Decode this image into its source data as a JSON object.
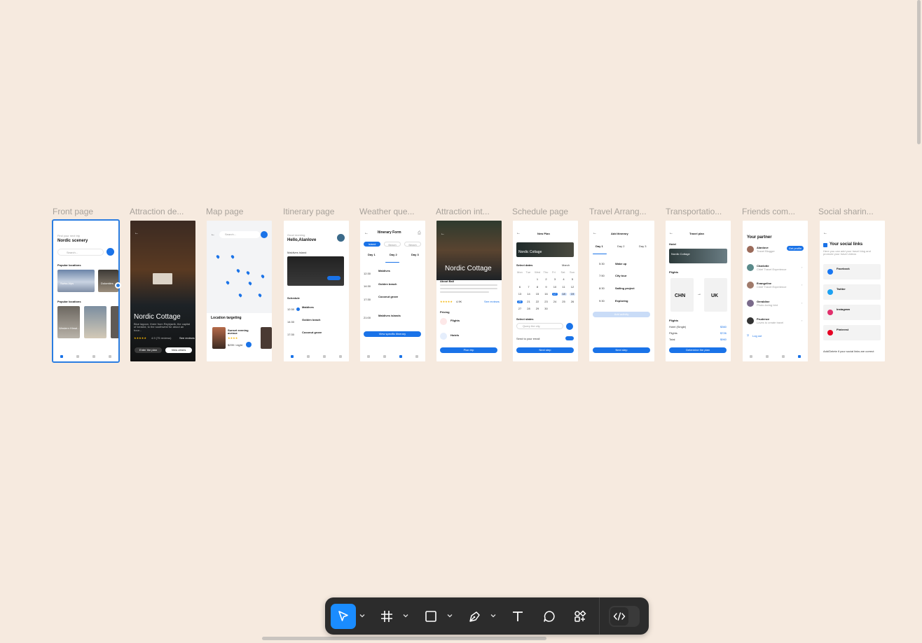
{
  "canvas": {
    "background": "#f6eadf",
    "accent": "#2a7de1"
  },
  "frames": [
    {
      "label": "Front page"
    },
    {
      "label": "Attraction de..."
    },
    {
      "label": "Map page"
    },
    {
      "label": "Itinerary page"
    },
    {
      "label": "Weather que..."
    },
    {
      "label": "Attraction int..."
    },
    {
      "label": "Schedule page"
    },
    {
      "label": "Travel Arrang..."
    },
    {
      "label": "Transportatio..."
    },
    {
      "label": "Friends com..."
    },
    {
      "label": "Social sharin..."
    }
  ],
  "front": {
    "kicker": "Find your next trip",
    "title": "Nordic scenery",
    "search_placeholder": "Search...",
    "section1": "Popular locations",
    "card1": "Swiss Alps",
    "card2": "Dolomites",
    "section2": "Popular locations",
    "card3": "Western Himal..."
  },
  "attraction": {
    "title": "Nordic Cottage",
    "desc": "Blue lagoon, three from Reykjavik, the capital of Iceland, to the southwest for about an hour...",
    "rating": "4.9 (75 reviews)",
    "see_reviews": "See reviews",
    "btn_plan": "Enter the plan",
    "btn_others": "View others"
  },
  "map": {
    "search_placeholder": "Search...",
    "section": "Location targeting",
    "place": "Sunset evening avenue",
    "price": "$299 / night"
  },
  "itinerary": {
    "greet": "Good morning",
    "name": "Hello,Alanlove",
    "island": "Maldives island",
    "schedule": "Schedule",
    "items": [
      {
        "time": "12:30",
        "title": "Maldives"
      },
      {
        "time": "14:30",
        "title": "Golden beach"
      },
      {
        "time": "17:30",
        "title": "Coconut grove"
      }
    ]
  },
  "weather": {
    "title": "Itinerary Form",
    "chips": [
      "Island",
      "Beach",
      "Beach"
    ],
    "days": [
      "Day 1",
      "Day 2",
      "Day 3"
    ],
    "items": [
      {
        "time": "12:30",
        "title": "Maldives"
      },
      {
        "time": "14:30",
        "title": "Golden beach"
      },
      {
        "time": "17:30",
        "title": "Coconut grove"
      },
      {
        "time": "21:00",
        "title": "Maldives islands"
      }
    ],
    "cta": "View specific itinerary"
  },
  "attraction_info": {
    "title": "Nordic Cottage",
    "about": "About Bali",
    "rating": "4.9K",
    "see_more": "See reviews",
    "pricing": "Pricing",
    "flights": "Flights",
    "hotels": "Hotels",
    "cta": "Plan trip"
  },
  "schedule": {
    "title": "New Plan",
    "banner": "Nordic Cottage",
    "select_dates": "Select dates",
    "month": "March",
    "weekdays": [
      "Mon",
      "Tue",
      "Wed",
      "Thu",
      "Fri",
      "Sat",
      "Sun"
    ],
    "days": [
      "",
      "",
      "1",
      "2",
      "3",
      "4",
      "5",
      "6",
      "7",
      "8",
      "9",
      "10",
      "11",
      "12",
      "13",
      "14",
      "15",
      "16",
      "17",
      "18",
      "19",
      "20",
      "21",
      "22",
      "23",
      "24",
      "25",
      "26",
      "27",
      "28",
      "29",
      "30",
      "",
      "",
      ""
    ],
    "selected_range": [
      17,
      20
    ],
    "select_states": "Select states",
    "search_placeholder": "Query the city",
    "send_email": "Send to your email",
    "cta": "Next step"
  },
  "travel": {
    "title": "Add itinerary",
    "days": [
      "Day 1",
      "Day 2",
      "Day 3"
    ],
    "items": [
      {
        "time": "5:30",
        "title": "Wake up"
      },
      {
        "time": "7:50",
        "title": "City tour"
      },
      {
        "time": "8:30",
        "title": "Sailing project"
      },
      {
        "time": "9:30",
        "title": "Exploring"
      }
    ],
    "add": "Add activity",
    "cta": "Next step"
  },
  "transport": {
    "title": "Travel plan",
    "hotel": "Hotel",
    "hotel_name": "Nordic Cottage",
    "flights": "Flights",
    "from": "CHN",
    "to": "UK",
    "rows": [
      {
        "k": "Hotel (Single)",
        "v": "$360"
      },
      {
        "k": "Flights",
        "v": "$726"
      },
      {
        "k": "Total",
        "v": "$960"
      }
    ],
    "cta": "Determine the plan"
  },
  "friends": {
    "title": "Your partner",
    "follow": "Get profile",
    "people": [
      {
        "name": "Alanlove",
        "sub": "Travel Blogger"
      },
      {
        "name": "Charlotte",
        "sub": "Chief Travel Experience"
      },
      {
        "name": "Evangeline",
        "sub": "Chief Travel Experience"
      },
      {
        "name": "Geraldine",
        "sub": "Photo-loving bird"
      },
      {
        "name": "Prudence",
        "sub": "Loves to create travel"
      }
    ],
    "logout": "Log out"
  },
  "social": {
    "title": "Your social links",
    "desc": "Here you can add your travel blog and promote your travel videos",
    "links": [
      {
        "name": "Facebook",
        "color": "#1877f2"
      },
      {
        "name": "Twitter",
        "color": "#1da1f2"
      },
      {
        "name": "Instagram",
        "color": "#e1306c"
      },
      {
        "name": "Pinterest",
        "color": "#e60023"
      }
    ],
    "footer": "Add/Delete if your social links are correct"
  }
}
